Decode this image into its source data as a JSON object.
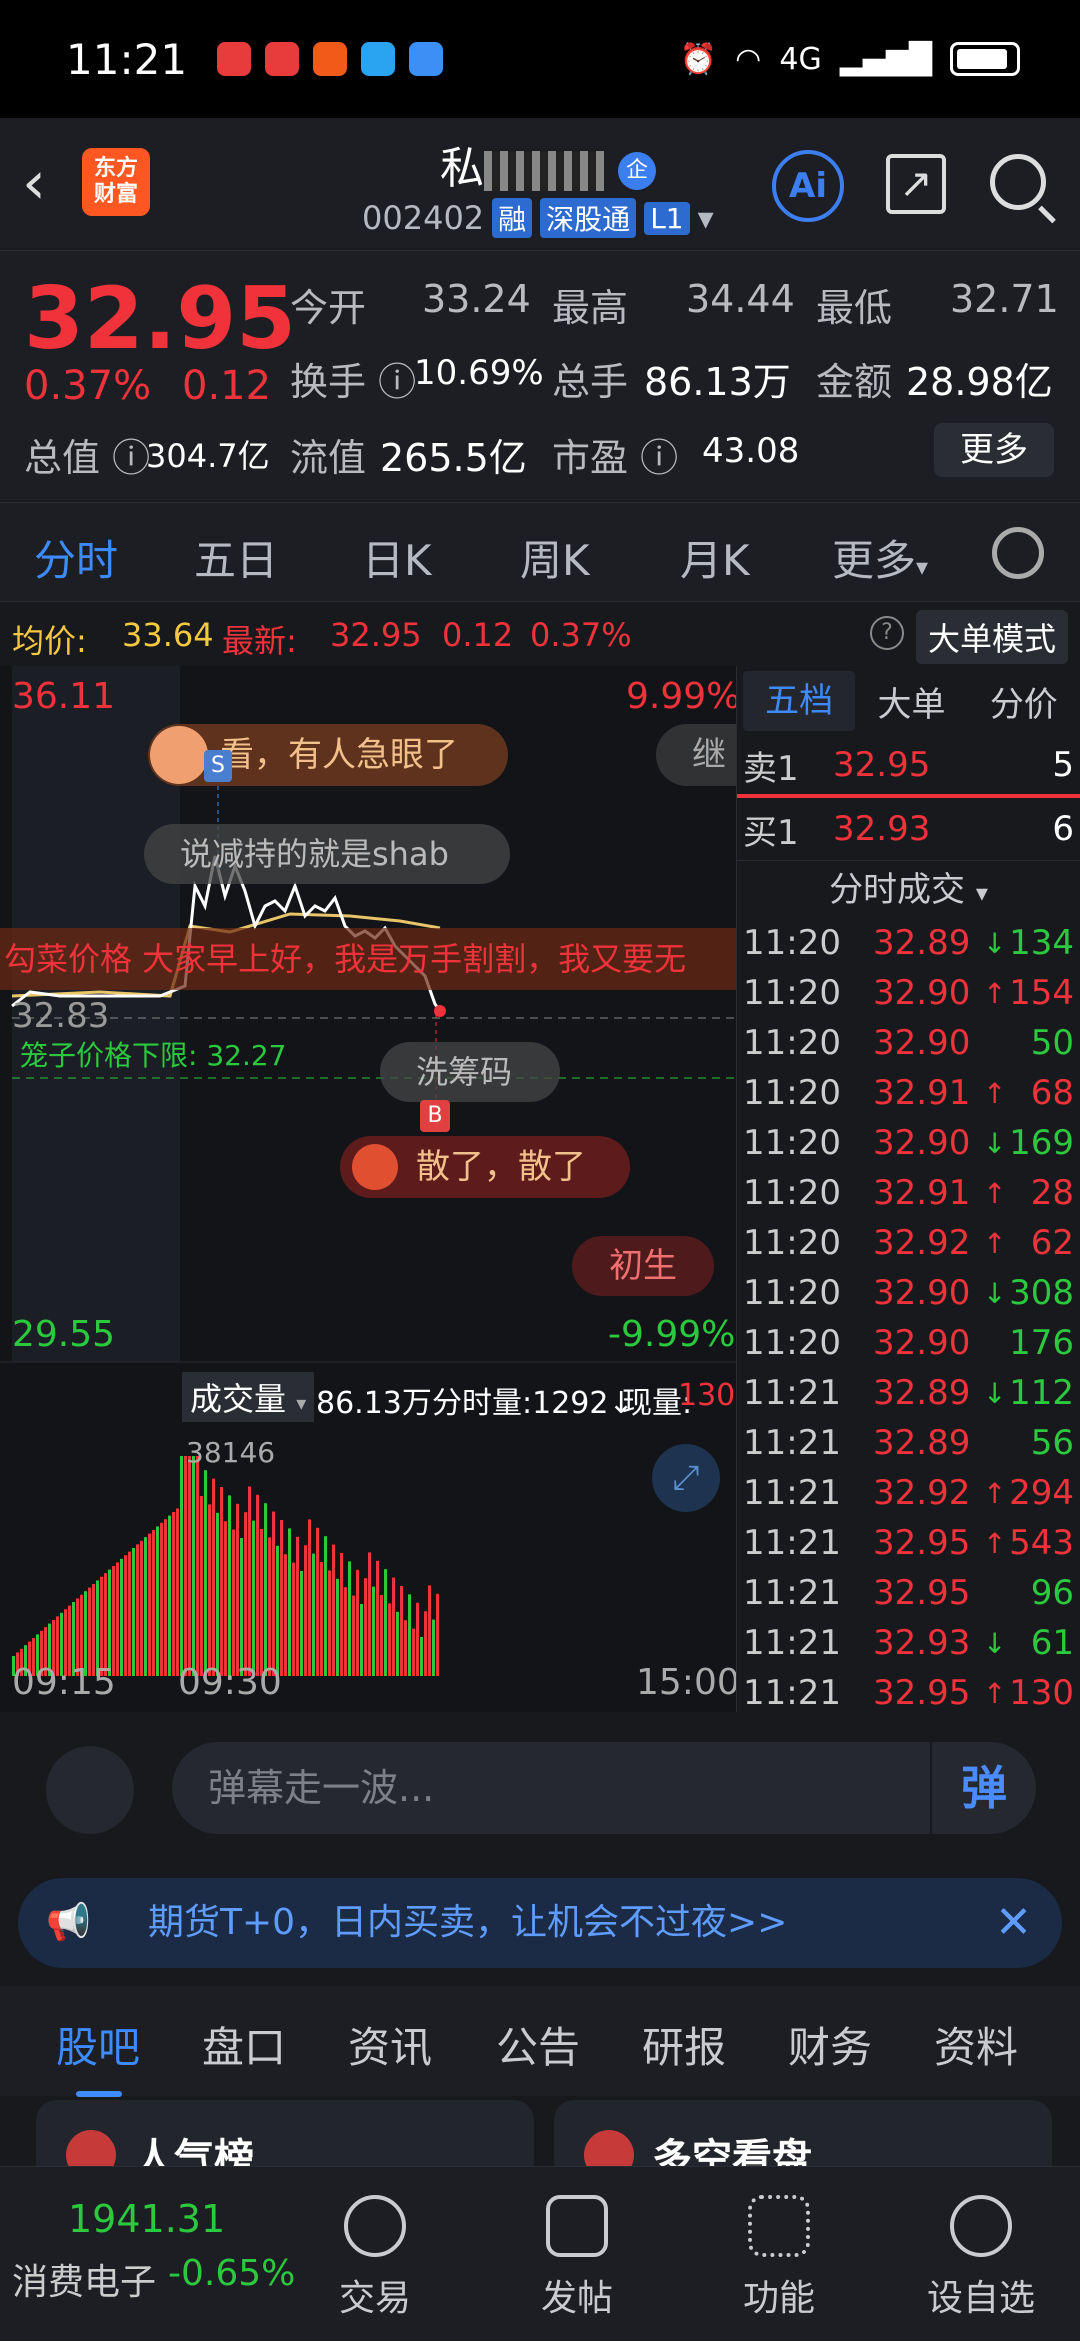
{
  "status": {
    "time": "11:21",
    "network": "4G"
  },
  "header": {
    "name_prefix": "私",
    "badge": "企",
    "code": "002402",
    "tags": [
      "融",
      "深股通",
      "L1"
    ],
    "ai": "Ai"
  },
  "quote": {
    "price": "32.95",
    "pct": "0.37%",
    "change": "0.12",
    "open_label": "今开",
    "open": "33.24",
    "high_label": "最高",
    "high": "34.44",
    "low_label": "最低",
    "low": "32.71",
    "turnover_label": "换手",
    "turnover": "10.69%",
    "volume_label": "总手",
    "volume": "86.13万",
    "amount_label": "金额",
    "amount": "28.98亿",
    "mcap_label": "总值",
    "mcap": "304.7亿",
    "float_label": "流值",
    "float": "265.5亿",
    "pe_label": "市盈",
    "pe": "43.08",
    "more": "更多"
  },
  "tabs": [
    "分时",
    "五日",
    "日K",
    "周K",
    "月K",
    "更多"
  ],
  "infobar": {
    "avg_label": "均价:",
    "avg": "33.64",
    "latest_label": "最新:",
    "latest": "32.95",
    "chg": "0.12",
    "pct": "0.37%",
    "mode": "大单模式"
  },
  "chart": {
    "y_top": "36.11",
    "y_top_pct": "9.99%",
    "y_bottom": "29.55",
    "y_bottom_pct": "-9.99%",
    "ref": "32.83",
    "cage_label": "笼子价格下限: 32.27",
    "danmu": [
      "看，有人急眼了",
      "继",
      "说减持的就是shab",
      "勾菜价格 大家早上好，我是万手割割，我又要无",
      "洗筹码",
      "散了，散了",
      "初生"
    ],
    "marker_s": "S",
    "marker_b": "B",
    "vol_label": "成交量",
    "vol_total": "86.13万",
    "vol_minute": "分时量:1292↓",
    "vol_now_label": "现量:",
    "vol_now": "130",
    "vol_max": "38146",
    "x_labels": [
      "09:15",
      "09:30",
      "15:00"
    ]
  },
  "orderbook": {
    "tabs": [
      "五档",
      "大单",
      "分价"
    ],
    "sell": {
      "label": "卖1",
      "price": "32.95",
      "qty": "5"
    },
    "buy": {
      "label": "买1",
      "price": "32.93",
      "qty": "6"
    },
    "ticks_title": "分时成交",
    "ticks": [
      {
        "t": "11:20",
        "p": "32.89",
        "d": "↓",
        "v": "134",
        "c": "green"
      },
      {
        "t": "11:20",
        "p": "32.90",
        "d": "↑",
        "v": "154",
        "c": "red"
      },
      {
        "t": "11:20",
        "p": "32.90",
        "d": "",
        "v": "50",
        "c": "green"
      },
      {
        "t": "11:20",
        "p": "32.91",
        "d": "↑",
        "v": "68",
        "c": "red"
      },
      {
        "t": "11:20",
        "p": "32.90",
        "d": "↓",
        "v": "169",
        "c": "green"
      },
      {
        "t": "11:20",
        "p": "32.91",
        "d": "↑",
        "v": "28",
        "c": "red"
      },
      {
        "t": "11:20",
        "p": "32.92",
        "d": "↑",
        "v": "62",
        "c": "red"
      },
      {
        "t": "11:20",
        "p": "32.90",
        "d": "↓",
        "v": "308",
        "c": "green"
      },
      {
        "t": "11:20",
        "p": "32.90",
        "d": "",
        "v": "176",
        "c": "green"
      },
      {
        "t": "11:21",
        "p": "32.89",
        "d": "↓",
        "v": "112",
        "c": "green"
      },
      {
        "t": "11:21",
        "p": "32.89",
        "d": "",
        "v": "56",
        "c": "green"
      },
      {
        "t": "11:21",
        "p": "32.92",
        "d": "↑",
        "v": "294",
        "c": "red"
      },
      {
        "t": "11:21",
        "p": "32.95",
        "d": "↑",
        "v": "543",
        "c": "red"
      },
      {
        "t": "11:21",
        "p": "32.95",
        "d": "",
        "v": "96",
        "c": "green"
      },
      {
        "t": "11:21",
        "p": "32.93",
        "d": "↓",
        "v": "61",
        "c": "green"
      },
      {
        "t": "11:21",
        "p": "32.95",
        "d": "↑",
        "v": "130",
        "c": "red"
      }
    ]
  },
  "danmu_bar": {
    "placeholder": "弹幕走一波...",
    "send": "弹"
  },
  "promo": {
    "text": "期货T+0，日内买卖，让机会不过夜>>"
  },
  "bottom_tabs": [
    "股吧",
    "盘口",
    "资讯",
    "公告",
    "研报",
    "财务",
    "资料"
  ],
  "cards": [
    "人气榜",
    "多空看盘"
  ],
  "nav": {
    "index_value": "1941.31",
    "index_name": "消费电子",
    "index_pct": "-0.65%",
    "items": [
      "交易",
      "发帖",
      "功能",
      "设自选"
    ]
  }
}
